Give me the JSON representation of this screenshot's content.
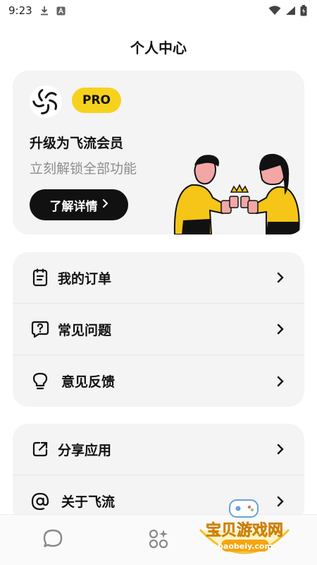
{
  "status_bar": {
    "time": "9:23"
  },
  "header": {
    "title": "个人中心"
  },
  "pro_card": {
    "badge": "PRO",
    "title": "升级为飞流会员",
    "subtitle": "立刻解锁全部功能",
    "button_label": "了解详情",
    "accent_color": "#f7d21c"
  },
  "menu_group_1": [
    {
      "label": "我的订单",
      "icon": "order-list-icon"
    },
    {
      "label": "常见问题",
      "icon": "question-bubble-icon"
    },
    {
      "label": "意见反馈",
      "icon": "lightbulb-icon"
    }
  ],
  "menu_group_2": [
    {
      "label": "分享应用",
      "icon": "share-external-icon"
    },
    {
      "label": "关于飞流",
      "icon": "at-sign-icon"
    }
  ],
  "bottom_nav": [
    {
      "icon": "chat-bubble-icon"
    },
    {
      "icon": "apps-sparkle-icon"
    },
    {
      "icon": "profile-icon"
    }
  ],
  "watermark": {
    "title": "宝贝游戏网",
    "url": "baobeiy.com"
  }
}
